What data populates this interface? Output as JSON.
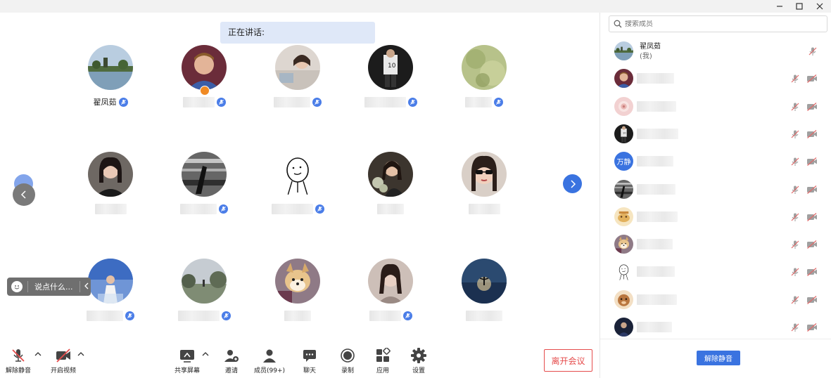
{
  "speaking": {
    "label": "正在讲话:"
  },
  "tiles": [
    {
      "row": 0,
      "col": 0,
      "name": "翟凤茹",
      "has_name": true,
      "mic_badge": true,
      "avatar": "lake"
    },
    {
      "row": 0,
      "col": 1,
      "name": "",
      "has_name": false,
      "mic_badge": true,
      "host_badge": true,
      "avatar": "footballer"
    },
    {
      "row": 0,
      "col": 2,
      "name": "",
      "has_name": false,
      "mic_badge": true,
      "avatar": "girl-bed"
    },
    {
      "row": 0,
      "col": 3,
      "name": "",
      "has_name": false,
      "mic_badge": true,
      "avatar": "soccer-dark"
    },
    {
      "row": 0,
      "col": 4,
      "name": "",
      "has_name": false,
      "mic_badge": true,
      "avatar": "green-texture"
    },
    {
      "row": 1,
      "col": 0,
      "name": "",
      "has_name": false,
      "mic_badge": false,
      "avatar": "girl-dark"
    },
    {
      "row": 1,
      "col": 1,
      "name": "",
      "has_name": false,
      "mic_badge": true,
      "avatar": "bw-motion"
    },
    {
      "row": 1,
      "col": 2,
      "name": "",
      "has_name": false,
      "mic_badge": true,
      "avatar": "sketch"
    },
    {
      "row": 1,
      "col": 3,
      "name": "",
      "has_name": false,
      "mic_badge": false,
      "avatar": "girl-flowers"
    },
    {
      "row": 1,
      "col": 4,
      "name": "",
      "has_name": false,
      "mic_badge": false,
      "avatar": "girl-sunglasses"
    },
    {
      "row": 2,
      "col": 0,
      "name": "",
      "has_name": false,
      "mic_badge": true,
      "avatar": "sky-person"
    },
    {
      "row": 2,
      "col": 1,
      "name": "",
      "has_name": false,
      "mic_badge": true,
      "avatar": "park"
    },
    {
      "row": 2,
      "col": 2,
      "name": "",
      "has_name": false,
      "mic_badge": false,
      "avatar": "dog"
    },
    {
      "row": 2,
      "col": 3,
      "name": "",
      "has_name": false,
      "mic_badge": true,
      "avatar": "girl-bw"
    },
    {
      "row": 2,
      "col": 4,
      "name": "",
      "has_name": false,
      "mic_badge": false,
      "avatar": "sunset"
    }
  ],
  "chat": {
    "placeholder": "说点什么...",
    "collapse_icon": "chevron-left-icon"
  },
  "toolbar": {
    "unmute_label": "解除静音",
    "video_label": "开启视频",
    "share_label": "共享屏幕",
    "invite_label": "邀请",
    "members_label": "成员(99+)",
    "chat_label": "聊天",
    "record_label": "录制",
    "apps_label": "应用",
    "settings_label": "设置",
    "leave_label": "离开会议"
  },
  "panel": {
    "search_placeholder": "搜索成员",
    "self_name": "翟凤茹",
    "self_sub": "(我)",
    "members": [
      {
        "avatar": "lake",
        "self": true
      },
      {
        "avatar": "footballer"
      },
      {
        "avatar": "pink-pattern"
      },
      {
        "avatar": "soccer-dark"
      },
      {
        "avatar": "text",
        "text": "万静",
        "color": "#3a73e0"
      },
      {
        "avatar": "bw-motion"
      },
      {
        "avatar": "cartoon-yellow"
      },
      {
        "avatar": "dog"
      },
      {
        "avatar": "sketch"
      },
      {
        "avatar": "cartoon-brown"
      },
      {
        "avatar": "dark-person"
      }
    ],
    "unmute_all_label": "解除静音"
  },
  "colors": {
    "accent": "#3a73e0",
    "leave": "#e54c4c",
    "speaking_bg": "#dfe8f8"
  }
}
